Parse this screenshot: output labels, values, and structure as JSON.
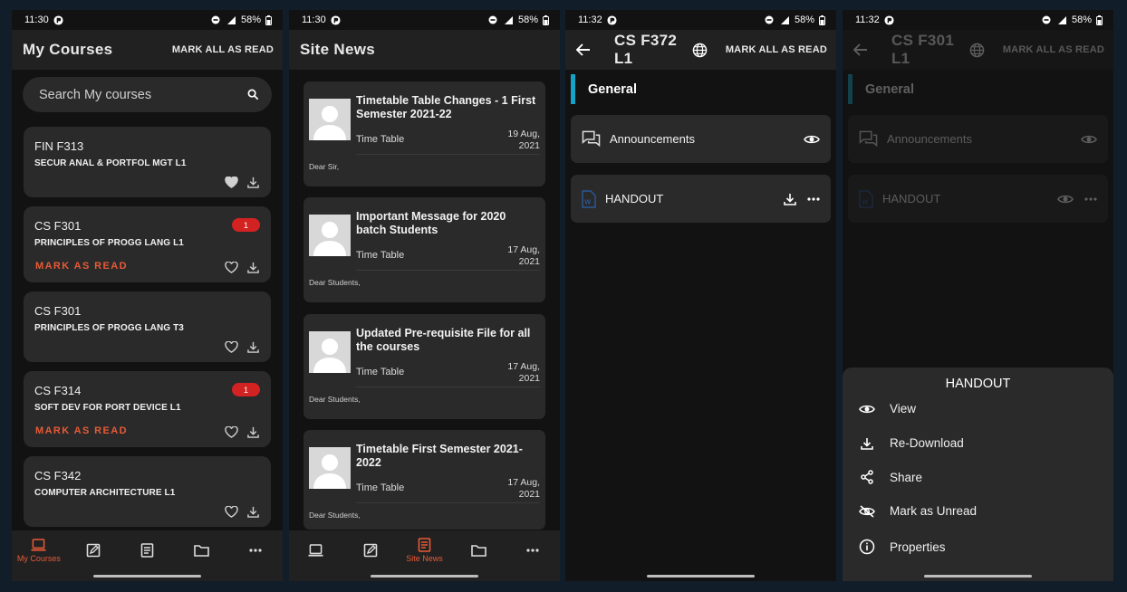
{
  "status_bars": [
    {
      "time": "11:30",
      "battery": "58%"
    },
    {
      "time": "11:30",
      "battery": "58%"
    },
    {
      "time": "11:32",
      "battery": "58%"
    },
    {
      "time": "11:32",
      "battery": "58%"
    }
  ],
  "screen1": {
    "title": "My Courses",
    "action": "MARK ALL AS READ",
    "search_placeholder": "Search My courses",
    "courses": [
      {
        "code": "FIN F313",
        "name": "SECUR ANAL & PORTFOL MGT L1",
        "badge": "",
        "mark": "",
        "favorited": true
      },
      {
        "code": "CS F301",
        "name": "PRINCIPLES OF PROGG LANG L1",
        "badge": "1",
        "mark": "MARK AS READ",
        "favorited": false
      },
      {
        "code": "CS F301",
        "name": "PRINCIPLES OF PROGG LANG T3",
        "badge": "",
        "mark": "",
        "favorited": false
      },
      {
        "code": "CS F314",
        "name": "SOFT DEV FOR PORT DEVICE L1",
        "badge": "1",
        "mark": "MARK AS READ",
        "favorited": false
      },
      {
        "code": "CS F342",
        "name": "COMPUTER ARCHITECTURE L1",
        "badge": "",
        "mark": "",
        "favorited": false
      }
    ],
    "nav_active_label": "My Courses"
  },
  "screen2": {
    "title": "Site News",
    "news": [
      {
        "title": "Timetable Table Changes - 1 First Semester 2021-22",
        "category": "Time Table",
        "date": "19 Aug, 2021",
        "snippet": "Dear Sir,"
      },
      {
        "title": "Important Message for 2020 batch Students",
        "category": "Time Table",
        "date": "17 Aug, 2021",
        "snippet": "Dear Students,"
      },
      {
        "title": "Updated Pre-requisite File for all the courses",
        "category": "Time Table",
        "date": "17 Aug, 2021",
        "snippet": "Dear Students,"
      },
      {
        "title": "Timetable First Semester 2021-2022",
        "category": "Time Table",
        "date": "17 Aug, 2021",
        "snippet": "Dear Students,"
      }
    ],
    "nav_active_label": "Site News"
  },
  "screen3": {
    "title": "CS F372 L1",
    "action": "MARK ALL AS READ",
    "section": "General",
    "modules": [
      {
        "name": "Announcements"
      },
      {
        "name": "HANDOUT"
      }
    ]
  },
  "screen4": {
    "title": "CS F301 L1",
    "action": "MARK ALL AS READ",
    "section": "General",
    "modules": [
      {
        "name": "Announcements"
      },
      {
        "name": "HANDOUT"
      }
    ],
    "sheet": {
      "title": "HANDOUT",
      "options": [
        {
          "label": "View",
          "icon": "eye-icon"
        },
        {
          "label": "Re-Download",
          "icon": "download-icon"
        },
        {
          "label": "Share",
          "icon": "share-icon"
        },
        {
          "label": "Mark as Unread",
          "icon": "eye-off-icon"
        },
        {
          "label": "Properties",
          "icon": "info-icon"
        }
      ]
    }
  },
  "colors": {
    "accent": "#e85a36",
    "badge": "#d32222",
    "section_bar": "#14a3c7",
    "surface": "#2a2a2a",
    "background": "#121212"
  }
}
